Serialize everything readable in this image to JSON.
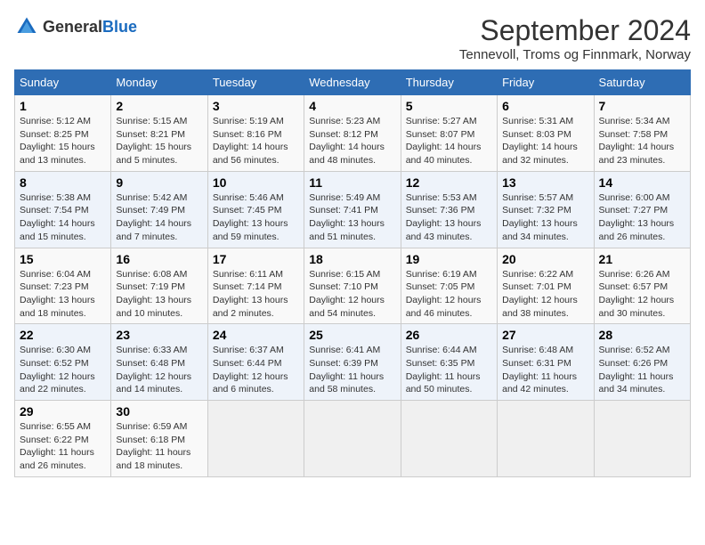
{
  "header": {
    "logo_general": "General",
    "logo_blue": "Blue",
    "month": "September 2024",
    "location": "Tennevoll, Troms og Finnmark, Norway"
  },
  "weekdays": [
    "Sunday",
    "Monday",
    "Tuesday",
    "Wednesday",
    "Thursday",
    "Friday",
    "Saturday"
  ],
  "weeks": [
    [
      {
        "day": "1",
        "sunrise": "Sunrise: 5:12 AM",
        "sunset": "Sunset: 8:25 PM",
        "daylight": "Daylight: 15 hours and 13 minutes."
      },
      {
        "day": "2",
        "sunrise": "Sunrise: 5:15 AM",
        "sunset": "Sunset: 8:21 PM",
        "daylight": "Daylight: 15 hours and 5 minutes."
      },
      {
        "day": "3",
        "sunrise": "Sunrise: 5:19 AM",
        "sunset": "Sunset: 8:16 PM",
        "daylight": "Daylight: 14 hours and 56 minutes."
      },
      {
        "day": "4",
        "sunrise": "Sunrise: 5:23 AM",
        "sunset": "Sunset: 8:12 PM",
        "daylight": "Daylight: 14 hours and 48 minutes."
      },
      {
        "day": "5",
        "sunrise": "Sunrise: 5:27 AM",
        "sunset": "Sunset: 8:07 PM",
        "daylight": "Daylight: 14 hours and 40 minutes."
      },
      {
        "day": "6",
        "sunrise": "Sunrise: 5:31 AM",
        "sunset": "Sunset: 8:03 PM",
        "daylight": "Daylight: 14 hours and 32 minutes."
      },
      {
        "day": "7",
        "sunrise": "Sunrise: 5:34 AM",
        "sunset": "Sunset: 7:58 PM",
        "daylight": "Daylight: 14 hours and 23 minutes."
      }
    ],
    [
      {
        "day": "8",
        "sunrise": "Sunrise: 5:38 AM",
        "sunset": "Sunset: 7:54 PM",
        "daylight": "Daylight: 14 hours and 15 minutes."
      },
      {
        "day": "9",
        "sunrise": "Sunrise: 5:42 AM",
        "sunset": "Sunset: 7:49 PM",
        "daylight": "Daylight: 14 hours and 7 minutes."
      },
      {
        "day": "10",
        "sunrise": "Sunrise: 5:46 AM",
        "sunset": "Sunset: 7:45 PM",
        "daylight": "Daylight: 13 hours and 59 minutes."
      },
      {
        "day": "11",
        "sunrise": "Sunrise: 5:49 AM",
        "sunset": "Sunset: 7:41 PM",
        "daylight": "Daylight: 13 hours and 51 minutes."
      },
      {
        "day": "12",
        "sunrise": "Sunrise: 5:53 AM",
        "sunset": "Sunset: 7:36 PM",
        "daylight": "Daylight: 13 hours and 43 minutes."
      },
      {
        "day": "13",
        "sunrise": "Sunrise: 5:57 AM",
        "sunset": "Sunset: 7:32 PM",
        "daylight": "Daylight: 13 hours and 34 minutes."
      },
      {
        "day": "14",
        "sunrise": "Sunrise: 6:00 AM",
        "sunset": "Sunset: 7:27 PM",
        "daylight": "Daylight: 13 hours and 26 minutes."
      }
    ],
    [
      {
        "day": "15",
        "sunrise": "Sunrise: 6:04 AM",
        "sunset": "Sunset: 7:23 PM",
        "daylight": "Daylight: 13 hours and 18 minutes."
      },
      {
        "day": "16",
        "sunrise": "Sunrise: 6:08 AM",
        "sunset": "Sunset: 7:19 PM",
        "daylight": "Daylight: 13 hours and 10 minutes."
      },
      {
        "day": "17",
        "sunrise": "Sunrise: 6:11 AM",
        "sunset": "Sunset: 7:14 PM",
        "daylight": "Daylight: 13 hours and 2 minutes."
      },
      {
        "day": "18",
        "sunrise": "Sunrise: 6:15 AM",
        "sunset": "Sunset: 7:10 PM",
        "daylight": "Daylight: 12 hours and 54 minutes."
      },
      {
        "day": "19",
        "sunrise": "Sunrise: 6:19 AM",
        "sunset": "Sunset: 7:05 PM",
        "daylight": "Daylight: 12 hours and 46 minutes."
      },
      {
        "day": "20",
        "sunrise": "Sunrise: 6:22 AM",
        "sunset": "Sunset: 7:01 PM",
        "daylight": "Daylight: 12 hours and 38 minutes."
      },
      {
        "day": "21",
        "sunrise": "Sunrise: 6:26 AM",
        "sunset": "Sunset: 6:57 PM",
        "daylight": "Daylight: 12 hours and 30 minutes."
      }
    ],
    [
      {
        "day": "22",
        "sunrise": "Sunrise: 6:30 AM",
        "sunset": "Sunset: 6:52 PM",
        "daylight": "Daylight: 12 hours and 22 minutes."
      },
      {
        "day": "23",
        "sunrise": "Sunrise: 6:33 AM",
        "sunset": "Sunset: 6:48 PM",
        "daylight": "Daylight: 12 hours and 14 minutes."
      },
      {
        "day": "24",
        "sunrise": "Sunrise: 6:37 AM",
        "sunset": "Sunset: 6:44 PM",
        "daylight": "Daylight: 12 hours and 6 minutes."
      },
      {
        "day": "25",
        "sunrise": "Sunrise: 6:41 AM",
        "sunset": "Sunset: 6:39 PM",
        "daylight": "Daylight: 11 hours and 58 minutes."
      },
      {
        "day": "26",
        "sunrise": "Sunrise: 6:44 AM",
        "sunset": "Sunset: 6:35 PM",
        "daylight": "Daylight: 11 hours and 50 minutes."
      },
      {
        "day": "27",
        "sunrise": "Sunrise: 6:48 AM",
        "sunset": "Sunset: 6:31 PM",
        "daylight": "Daylight: 11 hours and 42 minutes."
      },
      {
        "day": "28",
        "sunrise": "Sunrise: 6:52 AM",
        "sunset": "Sunset: 6:26 PM",
        "daylight": "Daylight: 11 hours and 34 minutes."
      }
    ],
    [
      {
        "day": "29",
        "sunrise": "Sunrise: 6:55 AM",
        "sunset": "Sunset: 6:22 PM",
        "daylight": "Daylight: 11 hours and 26 minutes."
      },
      {
        "day": "30",
        "sunrise": "Sunrise: 6:59 AM",
        "sunset": "Sunset: 6:18 PM",
        "daylight": "Daylight: 11 hours and 18 minutes."
      },
      {
        "day": "",
        "sunrise": "",
        "sunset": "",
        "daylight": ""
      },
      {
        "day": "",
        "sunrise": "",
        "sunset": "",
        "daylight": ""
      },
      {
        "day": "",
        "sunrise": "",
        "sunset": "",
        "daylight": ""
      },
      {
        "day": "",
        "sunrise": "",
        "sunset": "",
        "daylight": ""
      },
      {
        "day": "",
        "sunrise": "",
        "sunset": "",
        "daylight": ""
      }
    ]
  ]
}
